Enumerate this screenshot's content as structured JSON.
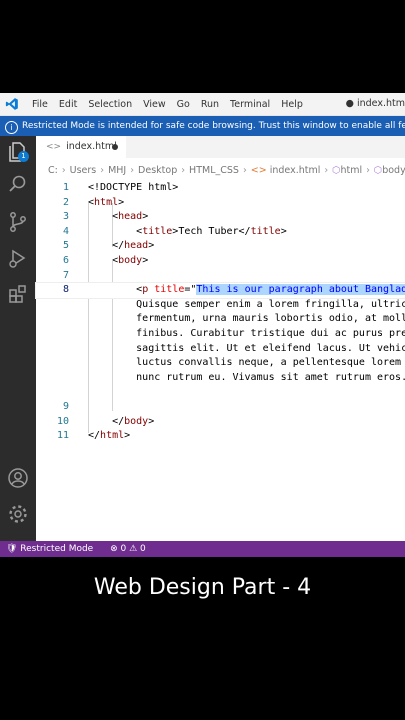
{
  "menu": [
    "File",
    "Edit",
    "Selection",
    "View",
    "Go",
    "Run",
    "Terminal",
    "Help"
  ],
  "window_title": "● index.htm",
  "banner": "Restricted Mode is intended for safe code browsing. Trust this window to enable all features.",
  "tab": {
    "label": "index.html"
  },
  "breadcrumb": [
    "C:",
    "Users",
    "MHJ",
    "Desktop",
    "HTML_CSS",
    "index.html",
    "html",
    "body"
  ],
  "activity_badge": "1",
  "editor": {
    "lines": [
      {
        "n": "1",
        "code": "<!DOCTYPE html>"
      },
      {
        "n": "2",
        "code": "<html>"
      },
      {
        "n": "3",
        "code": "    <head>"
      },
      {
        "n": "4",
        "code": "        <title>Tech Tuber</title>"
      },
      {
        "n": "5",
        "code": "    </head>"
      },
      {
        "n": "6",
        "code": "    <body>"
      },
      {
        "n": "7",
        "code": ""
      },
      {
        "n": "8",
        "code": "        <p title=\"This is our paragraph about Banglade"
      },
      {
        "n": "",
        "code": "        Quisque semper enim a lorem fringilla, ultric"
      },
      {
        "n": "",
        "code": "        fermentum, urna mauris lobortis odio, at molli"
      },
      {
        "n": "",
        "code": "        finibus. Curabitur tristique dui ac purus pre"
      },
      {
        "n": "",
        "code": "        sagittis elit. Ut et eleifend lacus. Ut vehic"
      },
      {
        "n": "",
        "code": "        luctus convallis neque, a pellentesque lorem e"
      },
      {
        "n": "",
        "code": "        nunc rutrum eu. Vivamus sit amet rutrum eros.-"
      },
      {
        "n": "",
        "code": ""
      },
      {
        "n": "9",
        "code": ""
      },
      {
        "n": "10",
        "code": "    </body>"
      },
      {
        "n": "11",
        "code": "</html>"
      }
    ]
  },
  "status": {
    "mode": "Restricted Mode",
    "errors": "0",
    "warnings": "0"
  },
  "caption": "Web Design Part - 4",
  "colors": {
    "accent": "#1a5fb4",
    "status": "#6e2d8f",
    "activity": "#2c2c2c"
  }
}
